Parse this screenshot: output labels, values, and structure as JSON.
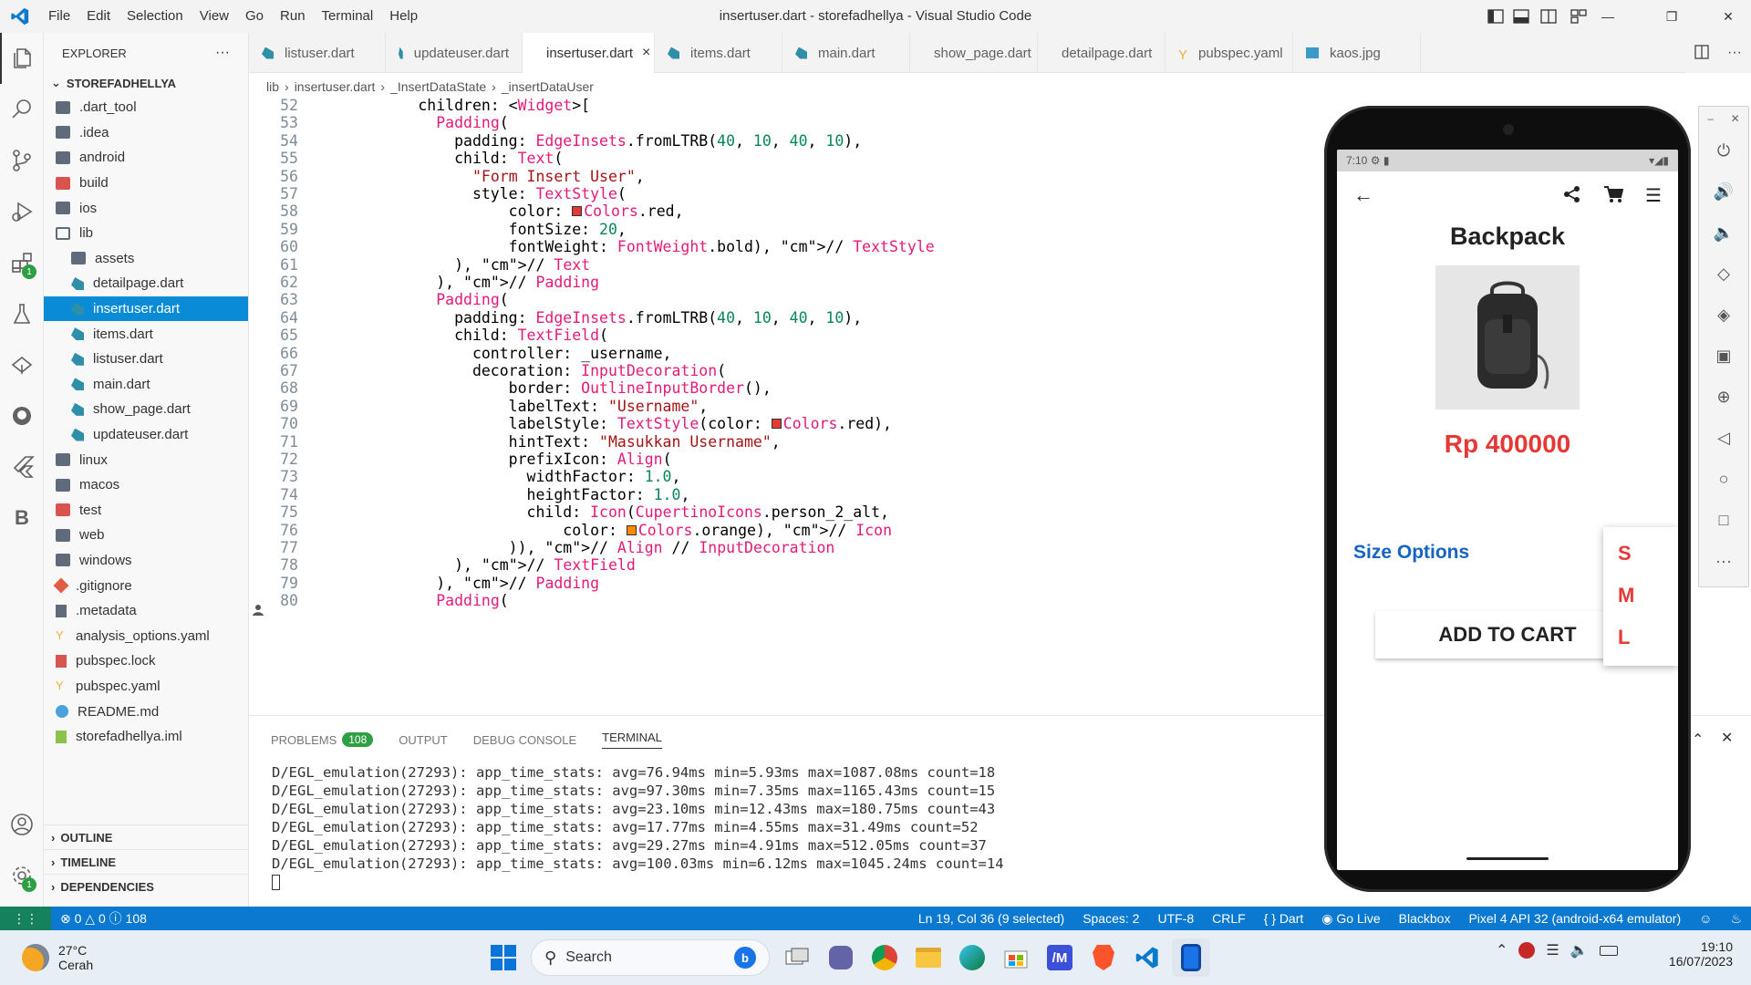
{
  "window": {
    "title": "insertuser.dart - storefadhellya - Visual Studio Code",
    "menu": [
      "File",
      "Edit",
      "Selection",
      "View",
      "Go",
      "Run",
      "Terminal",
      "Help"
    ]
  },
  "explorer": {
    "header": "EXPLORER",
    "more": "···",
    "root": "STOREFADHELLYA",
    "items": [
      {
        "label": ".dart_tool",
        "kind": "folder",
        "indent": 0
      },
      {
        "label": ".idea",
        "kind": "folder",
        "indent": 0
      },
      {
        "label": "android",
        "kind": "folder",
        "indent": 0
      },
      {
        "label": "build",
        "kind": "folder-red",
        "indent": 0
      },
      {
        "label": "ios",
        "kind": "folder",
        "indent": 0
      },
      {
        "label": "lib",
        "kind": "folder-open",
        "indent": 0
      },
      {
        "label": "assets",
        "kind": "folder-assets",
        "indent": 1
      },
      {
        "label": "detailpage.dart",
        "kind": "dart",
        "indent": 1
      },
      {
        "label": "insertuser.dart",
        "kind": "dart",
        "indent": 1,
        "selected": true
      },
      {
        "label": "items.dart",
        "kind": "dart",
        "indent": 1
      },
      {
        "label": "listuser.dart",
        "kind": "dart",
        "indent": 1
      },
      {
        "label": "main.dart",
        "kind": "dart",
        "indent": 1
      },
      {
        "label": "show_page.dart",
        "kind": "dart",
        "indent": 1
      },
      {
        "label": "updateuser.dart",
        "kind": "dart",
        "indent": 1
      },
      {
        "label": "linux",
        "kind": "folder",
        "indent": 0
      },
      {
        "label": "macos",
        "kind": "folder",
        "indent": 0
      },
      {
        "label": "test",
        "kind": "folder-red",
        "indent": 0
      },
      {
        "label": "web",
        "kind": "folder",
        "indent": 0
      },
      {
        "label": "windows",
        "kind": "folder",
        "indent": 0
      },
      {
        "label": ".gitignore",
        "kind": "git",
        "indent": 0
      },
      {
        "label": ".metadata",
        "kind": "meta",
        "indent": 0
      },
      {
        "label": "analysis_options.yaml",
        "kind": "yaml",
        "indent": 0
      },
      {
        "label": "pubspec.lock",
        "kind": "lock",
        "indent": 0
      },
      {
        "label": "pubspec.yaml",
        "kind": "yaml",
        "indent": 0
      },
      {
        "label": "README.md",
        "kind": "info",
        "indent": 0
      },
      {
        "label": "storefadhellya.iml",
        "kind": "iml",
        "indent": 0
      }
    ],
    "outline": "OUTLINE",
    "timeline": "TIMELINE",
    "dependencies": "DEPENDENCIES"
  },
  "tabs": [
    {
      "label": "listuser.dart"
    },
    {
      "label": "updateuser.dart"
    },
    {
      "label": "insertuser.dart",
      "active": true
    },
    {
      "label": "items.dart"
    },
    {
      "label": "main.dart"
    },
    {
      "label": "show_page.dart"
    },
    {
      "label": "detailpage.dart"
    },
    {
      "label": "pubspec.yaml",
      "kind": "yaml"
    },
    {
      "label": "kaos.jpg",
      "kind": "image"
    }
  ],
  "breadcrumb": [
    "lib",
    "insertuser.dart",
    "_InsertDataState",
    "_insertDataUser"
  ],
  "code_lines": [
    {
      "n": "52",
      "t": "          children: <Widget>["
    },
    {
      "n": "53",
      "t": "            Padding("
    },
    {
      "n": "54",
      "t": "              padding: EdgeInsets.fromLTRB(40, 10, 40, 10),"
    },
    {
      "n": "55",
      "t": "              child: Text("
    },
    {
      "n": "56",
      "t": "                \"Form Insert User\","
    },
    {
      "n": "57",
      "t": "                style: TextStyle("
    },
    {
      "n": "58",
      "t": "                    color: ■Colors.red,"
    },
    {
      "n": "59",
      "t": "                    fontSize: 20,"
    },
    {
      "n": "60",
      "t": "                    fontWeight: FontWeight.bold), // TextStyle"
    },
    {
      "n": "61",
      "t": "              ), // Text"
    },
    {
      "n": "62",
      "t": "            ), // Padding"
    },
    {
      "n": "63",
      "t": "            Padding("
    },
    {
      "n": "64",
      "t": "              padding: EdgeInsets.fromLTRB(40, 10, 40, 10),"
    },
    {
      "n": "65",
      "t": "              child: TextField("
    },
    {
      "n": "66",
      "t": "                controller: _username,"
    },
    {
      "n": "67",
      "t": "                decoration: InputDecoration("
    },
    {
      "n": "68",
      "t": "                    border: OutlineInputBorder(),"
    },
    {
      "n": "69",
      "t": "                    labelText: \"Username\","
    },
    {
      "n": "70",
      "t": "                    labelStyle: TextStyle(color: ■Colors.red),"
    },
    {
      "n": "71",
      "t": "                    hintText: \"Masukkan Username\","
    },
    {
      "n": "72",
      "t": "                    prefixIcon: Align("
    },
    {
      "n": "73",
      "t": "                      widthFactor: 1.0,"
    },
    {
      "n": "74",
      "t": "                      heightFactor: 1.0,"
    },
    {
      "n": "75",
      "t": "                      child: Icon(CupertinoIcons.person_2_alt,"
    },
    {
      "n": "76",
      "t": "                          color: ■Colors.orange), // Icon"
    },
    {
      "n": "77",
      "t": "                    )), // Align // InputDecoration"
    },
    {
      "n": "78",
      "t": "              ), // TextField"
    },
    {
      "n": "79",
      "t": "            ), // Padding"
    },
    {
      "n": "80",
      "t": "            Padding("
    }
  ],
  "panel": {
    "tabs": [
      "PROBLEMS",
      "OUTPUT",
      "DEBUG CONSOLE",
      "TERMINAL"
    ],
    "problems_count": "108",
    "active": "TERMINAL",
    "terminal": [
      "D/EGL_emulation(27293): app_time_stats: avg=76.94ms min=5.93ms max=1087.08ms count=18",
      "D/EGL_emulation(27293): app_time_stats: avg=97.30ms min=7.35ms max=1165.43ms count=15",
      "D/EGL_emulation(27293): app_time_stats: avg=23.10ms min=12.43ms max=180.75ms count=43",
      "D/EGL_emulation(27293): app_time_stats: avg=17.77ms min=4.55ms max=31.49ms count=52",
      "D/EGL_emulation(27293): app_time_stats: avg=29.27ms min=4.91ms max=512.05ms count=37",
      "D/EGL_emulation(27293): app_time_stats: avg=100.03ms min=6.12ms max=1045.24ms count=14"
    ]
  },
  "status": {
    "errors": "0",
    "warnings": "0",
    "infos": "108",
    "position": "Ln 19, Col 36 (9 selected)",
    "spaces": "Spaces: 2",
    "encoding": "UTF-8",
    "eol": "CRLF",
    "language": "{ } Dart",
    "golive": "Go Live",
    "blackbox": "Blackbox",
    "device": "Pixel 4 API 32 (android-x64 emulator)"
  },
  "phone": {
    "time": "7:10",
    "product": "Backpack",
    "price": "Rp 400000",
    "size_label": "Size Options",
    "sizes": [
      "S",
      "M",
      "L"
    ],
    "add_to_cart": "ADD TO CART"
  },
  "taskbar": {
    "weather_temp": "27°C",
    "weather_desc": "Cerah",
    "search": "Search",
    "time": "19:10",
    "date": "16/07/2023"
  },
  "colors": {
    "accent": "#0b79d0",
    "selection": "#0a8bd6",
    "badge": "#2ea043",
    "price_red": "#e53935",
    "link_blue": "#1565c0"
  }
}
